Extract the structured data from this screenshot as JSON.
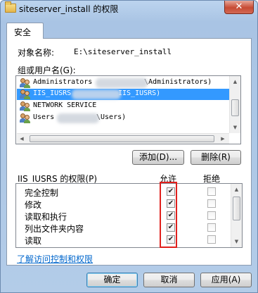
{
  "window": {
    "title": "siteserver_install 的权限",
    "close_glyph": "✕",
    "icon": "folder-icon"
  },
  "tab": {
    "label": "安全"
  },
  "object": {
    "label": "对象名称:",
    "value": "E:\\siteserver_install"
  },
  "groups": {
    "label": "组或用户名(G):",
    "items": [
      {
        "text": "Administrators",
        "text_right": "\\Administrators)",
        "selected": false
      },
      {
        "text": "IIS_IUSRS",
        "text_right": "IIS_IUSRS)",
        "selected": true
      },
      {
        "text": "NETWORK SERVICE",
        "text_right": "",
        "selected": false
      },
      {
        "text": "Users",
        "text_right": "\\Users)",
        "selected": false
      }
    ]
  },
  "buttons": {
    "add": "添加(D)...",
    "remove": "删除(R)",
    "ok": "确定",
    "cancel": "取消",
    "apply": "应用(A)"
  },
  "permissions": {
    "label": "IIS_IUSRS 的权限(P)",
    "allow_header": "允许",
    "deny_header": "拒绝",
    "rows": [
      {
        "name": "完全控制",
        "allow": true,
        "deny": false
      },
      {
        "name": "修改",
        "allow": true,
        "deny": false
      },
      {
        "name": "读取和执行",
        "allow": true,
        "deny": false
      },
      {
        "name": "列出文件夹内容",
        "allow": true,
        "deny": false
      },
      {
        "name": "读取",
        "allow": true,
        "deny": false
      }
    ]
  },
  "link": "了解访问控制和权限",
  "colors": {
    "selection": "#3399ff",
    "highlight_box": "#e0201c",
    "link": "#0066cc"
  }
}
